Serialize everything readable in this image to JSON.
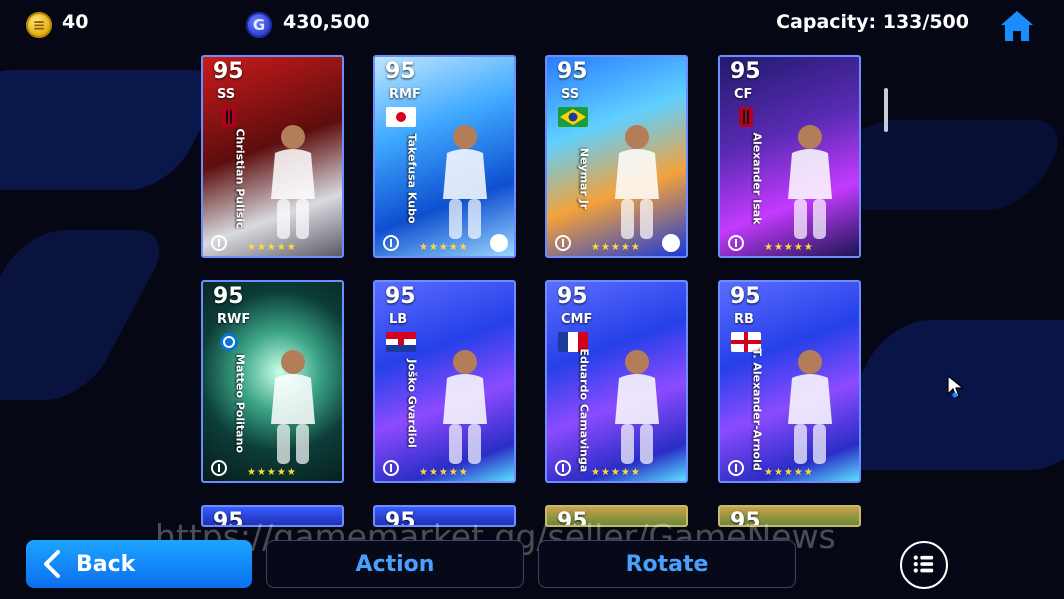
{
  "header": {
    "coins": "40",
    "gp_symbol": "G",
    "gp": "430,500",
    "capacity": "Capacity: 133/500",
    "home_icon": "home-icon"
  },
  "cards": [
    {
      "rating": "95",
      "position": "SS",
      "name": "Christian Pulisić",
      "theme": "c-pulisic",
      "flag": "ac-milan-crest",
      "skill": false
    },
    {
      "rating": "95",
      "position": "RMF",
      "name": "Takefusa Kubo",
      "theme": "c-kubo",
      "flag": "japan-flag",
      "skill": true
    },
    {
      "rating": "95",
      "position": "SS",
      "name": "Neymar Jr",
      "theme": "c-neymar",
      "flag": "brazil-flag",
      "skill": true
    },
    {
      "rating": "95",
      "position": "CF",
      "name": "Alexander Isak",
      "theme": "c-isak",
      "flag": "ac-milan-crest",
      "skill": false
    },
    {
      "rating": "95",
      "position": "RWF",
      "name": "Matteo Politano",
      "theme": "c-politano",
      "flag": "napoli-crest",
      "skill": false
    },
    {
      "rating": "95",
      "position": "LB",
      "name": "Joško Gvardiol",
      "theme": "c-blue",
      "flag": "croatia-flag",
      "skill": false
    },
    {
      "rating": "95",
      "position": "CMF",
      "name": "Eduardo Camavinga",
      "theme": "c-blue",
      "flag": "france-flag",
      "skill": false
    },
    {
      "rating": "95",
      "position": "RB",
      "name": "T. Alexander-Arnold",
      "theme": "c-blue",
      "flag": "england-flag",
      "skill": false
    },
    {
      "rating": "95",
      "theme": "c-row3a"
    },
    {
      "rating": "95",
      "theme": "c-row3a"
    },
    {
      "rating": "95",
      "theme": "c-row3b"
    },
    {
      "rating": "95",
      "theme": "c-row3b"
    }
  ],
  "stars": "★★★★★",
  "buttons": {
    "back": "Back",
    "action": "Action",
    "rotate": "Rotate"
  },
  "watermark": "https://gamemarket.gg/seller/GameNews",
  "colors": {
    "accent": "#1da4ff",
    "action_text": "#4aa0ff",
    "background": "#050814"
  }
}
